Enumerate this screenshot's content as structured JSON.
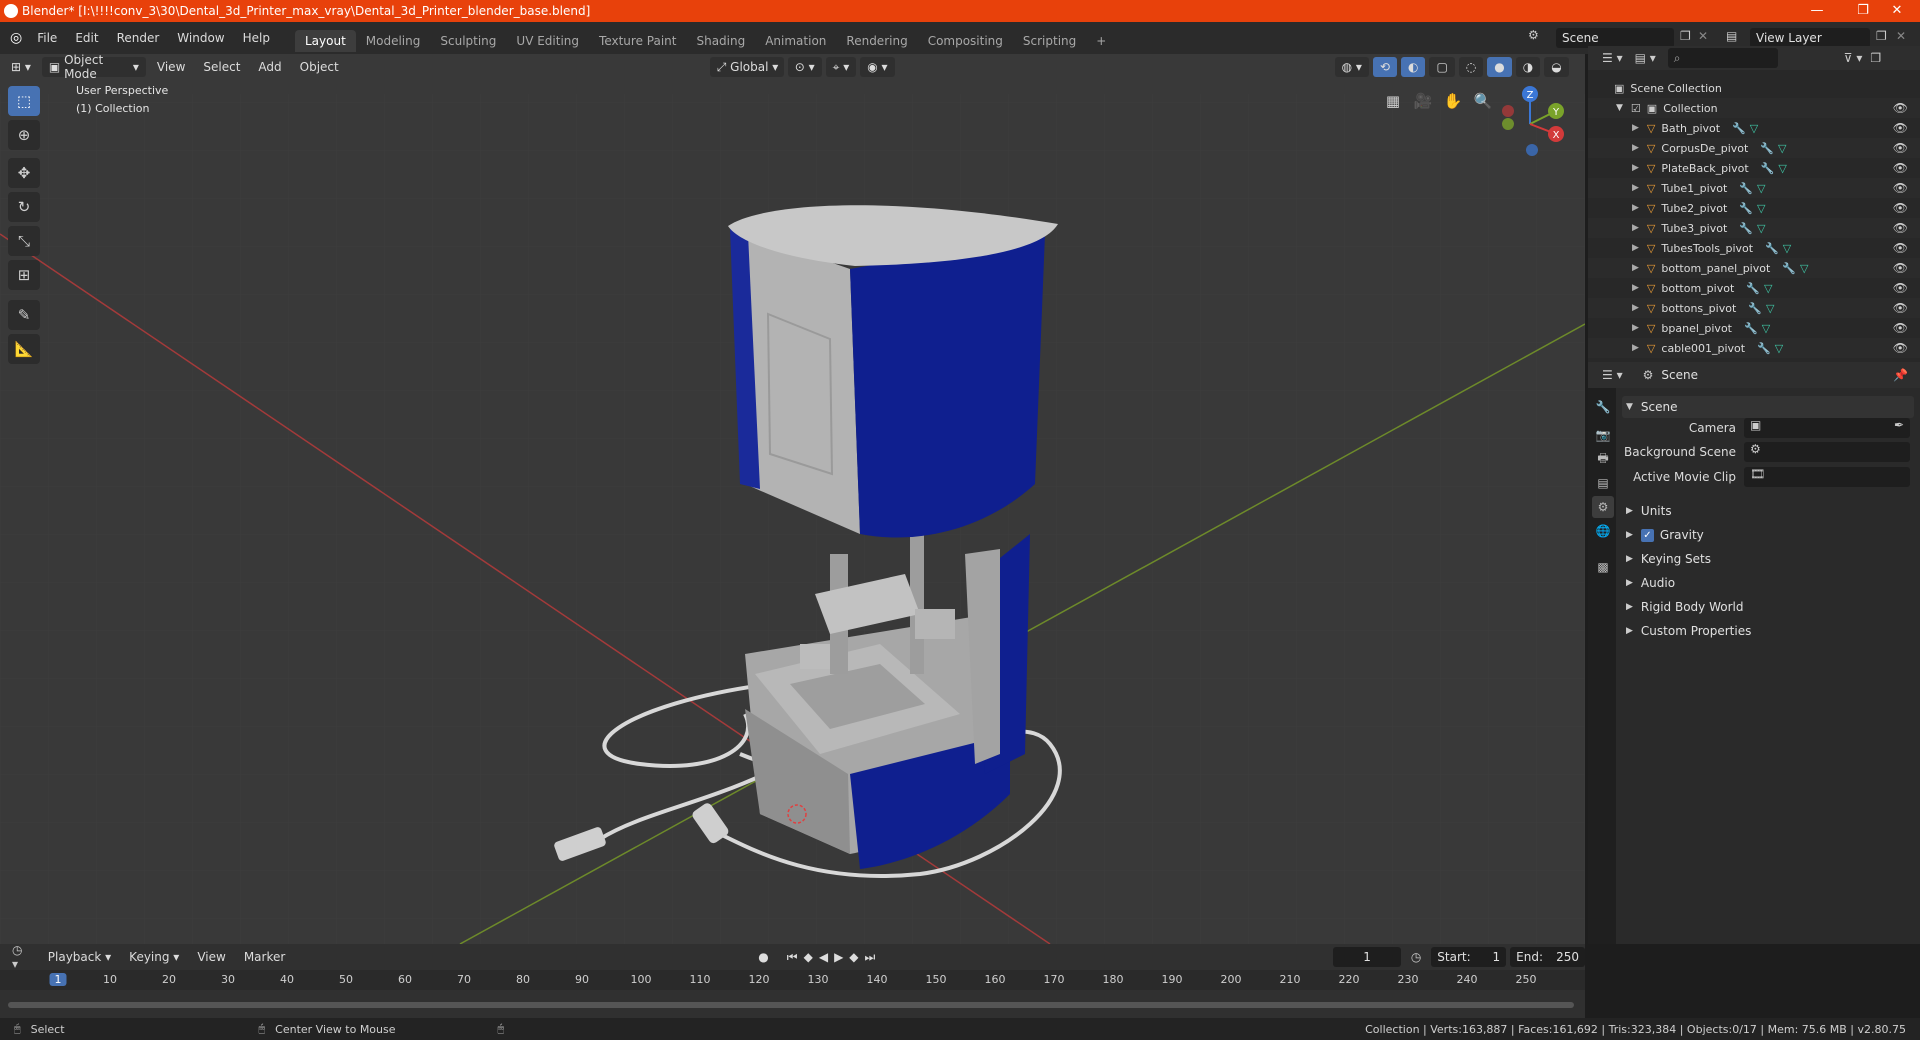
{
  "titlebar": {
    "title": "Blender* [I:\\!!!!conv_3\\30\\Dental_3d_Printer_max_vray\\Dental_3d_Printer_blender_base.blend]",
    "minimize": "—",
    "maximize": "❐",
    "close": "✕"
  },
  "menu": [
    "File",
    "Edit",
    "Render",
    "Window",
    "Help"
  ],
  "workspaces": [
    "Layout",
    "Modeling",
    "Sculpting",
    "UV Editing",
    "Texture Paint",
    "Shading",
    "Animation",
    "Rendering",
    "Compositing",
    "Scripting"
  ],
  "add_workspace": "+",
  "scene_field": "Scene",
  "view_layer_field": "View Layer",
  "viewport": {
    "mode": "Object Mode",
    "menus": [
      "View",
      "Select",
      "Add",
      "Object"
    ],
    "orientation": "Global",
    "overlay_title": "User Perspective",
    "overlay_subtitle": "(1) Collection",
    "gizmo": {
      "z": "Z",
      "y": "Y",
      "x": "X"
    }
  },
  "outliner": {
    "root": "Scene Collection",
    "collection": "Collection",
    "items": [
      "Bath_pivot",
      "CorpusDe_pivot",
      "PlateBack_pivot",
      "Tube1_pivot",
      "Tube2_pivot",
      "Tube3_pivot",
      "TubesTools_pivot",
      "bottom_panel_pivot",
      "bottom_pivot",
      "bottons_pivot",
      "bpanel_pivot",
      "cable001_pivot"
    ]
  },
  "properties": {
    "header": "Scene",
    "panel_title": "Scene",
    "camera_label": "Camera",
    "background_label": "Background Scene",
    "movie_clip_label": "Active Movie Clip",
    "subpanels": [
      "Units",
      "Gravity",
      "Keying Sets",
      "Audio",
      "Rigid Body World",
      "Custom Properties"
    ]
  },
  "timeline": {
    "menus": [
      "Playback",
      "Keying",
      "View",
      "Marker"
    ],
    "current_frame": "1",
    "start_label": "Start:",
    "start_value": "1",
    "end_label": "End:",
    "end_value": "250",
    "ticks": [
      "1",
      "10",
      "20",
      "30",
      "40",
      "50",
      "60",
      "70",
      "80",
      "90",
      "100",
      "110",
      "120",
      "130",
      "140",
      "150",
      "160",
      "170",
      "180",
      "190",
      "200",
      "210",
      "220",
      "230",
      "240",
      "250"
    ]
  },
  "statusbar": {
    "left": "Select",
    "middle": "Center View to Mouse",
    "right": "Collection | Verts:163,887 | Faces:161,692 | Tris:323,384 | Objects:0/17 | Mem: 75.6 MB | v2.80.75"
  },
  "colors": {
    "accent": "#4772b3",
    "titlebar": "#e8410b",
    "printer_blue": "#0f1f8f",
    "printer_grey": "#a9a9a9"
  }
}
